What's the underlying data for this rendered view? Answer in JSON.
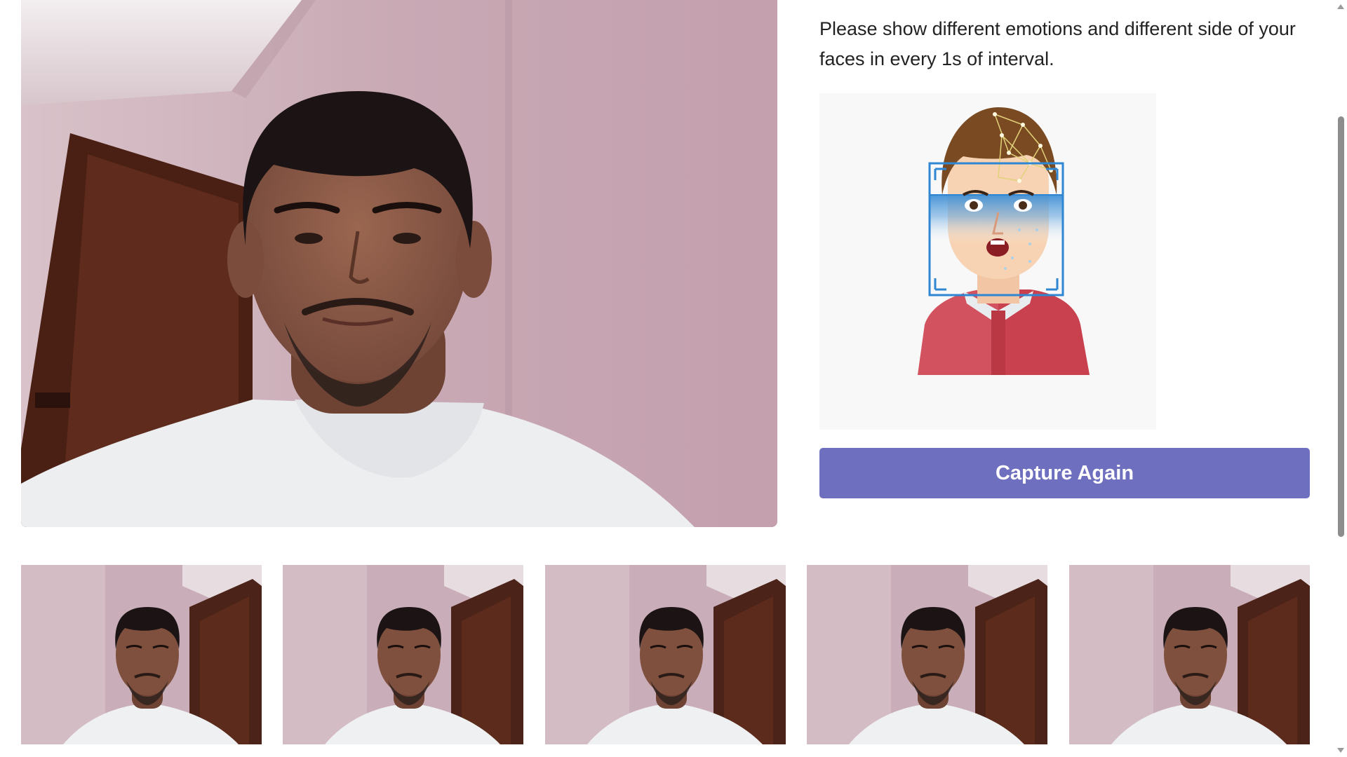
{
  "instruction": {
    "text": "Please show different emotions and different side of your faces in every 1s of interval."
  },
  "capture_button": {
    "label": "Capture Again"
  },
  "illustration": {
    "icon": "face-recognition-illustration"
  },
  "webcam": {
    "icon": "live-webcam-feed"
  },
  "thumbnails": [
    {
      "icon": "captured-face-photo"
    },
    {
      "icon": "captured-face-photo"
    },
    {
      "icon": "captured-face-photo"
    },
    {
      "icon": "captured-face-photo"
    },
    {
      "icon": "captured-face-photo"
    }
  ],
  "colors": {
    "button": "#6f6fc0",
    "wall": "#cfb1bb",
    "door": "#5a2a1c",
    "shirt": "#eef0f2",
    "skin": "#8a5a44",
    "hair": "#1c1414"
  }
}
